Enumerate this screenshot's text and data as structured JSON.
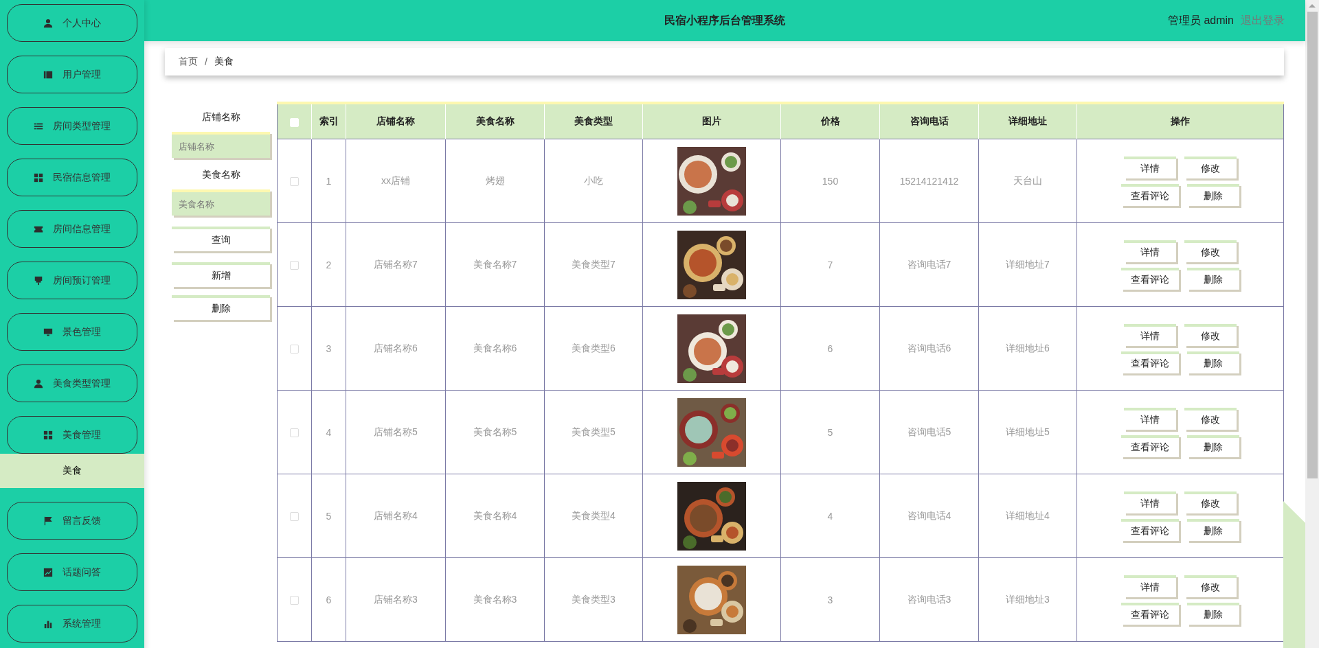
{
  "sidebar": {
    "items": [
      {
        "label": "个人中心",
        "selected": false
      },
      {
        "label": "用户管理",
        "selected": false
      },
      {
        "label": "房间类型管理",
        "selected": false
      },
      {
        "label": "民宿信息管理",
        "selected": false
      },
      {
        "label": "房间信息管理",
        "selected": false
      },
      {
        "label": "房间预订管理",
        "selected": false
      },
      {
        "label": "景色管理",
        "selected": false
      },
      {
        "label": "美食类型管理",
        "selected": false
      },
      {
        "label": "美食管理",
        "selected": false,
        "children": [
          {
            "label": "美食",
            "selected": true
          }
        ]
      },
      {
        "label": "留言反馈",
        "selected": false
      },
      {
        "label": "话题问答",
        "selected": false
      },
      {
        "label": "系统管理",
        "selected": false
      }
    ]
  },
  "header": {
    "title": "民宿小程序后台管理系统",
    "user": "管理员 admin",
    "logout": "退出登录"
  },
  "breadcrumb": [
    "首页",
    "美食"
  ],
  "breadcrumb_separator": "/",
  "filters": {
    "fields": [
      {
        "label": "店铺名称",
        "placeholder": "店铺名称"
      },
      {
        "label": "美食名称",
        "placeholder": "美食名称"
      }
    ],
    "buttons": [
      "查询",
      "新增",
      "删除"
    ]
  },
  "table": {
    "columns": [
      {
        "kind": "checkbox",
        "checked": false
      },
      {
        "kind": "text",
        "label": "索引"
      },
      {
        "kind": "text",
        "label": "店铺名称"
      },
      {
        "kind": "text",
        "label": "美食名称"
      },
      {
        "kind": "text",
        "label": "美食类型"
      },
      {
        "kind": "text",
        "label": "图片"
      },
      {
        "kind": "text",
        "label": "价格"
      },
      {
        "kind": "text",
        "label": "咨询电话"
      },
      {
        "kind": "text",
        "label": "详细地址"
      },
      {
        "kind": "text",
        "label": "操作"
      }
    ],
    "rows": [
      {
        "cells": [
          {
            "kind": "checkbox",
            "checked": false
          },
          {
            "kind": "text",
            "text": "1"
          },
          {
            "kind": "text",
            "text": "xx店铺"
          },
          {
            "kind": "text",
            "text": "烤翅"
          },
          {
            "kind": "text",
            "text": "小吃"
          },
          {
            "kind": "picture"
          },
          {
            "kind": "text",
            "text": "150"
          },
          {
            "kind": "text",
            "text": "15214121412"
          },
          {
            "kind": "text",
            "text": "天台山"
          },
          {
            "kind": "actions",
            "actions": [
              "详情",
              "修改",
              "查看评论",
              "删除"
            ]
          }
        ]
      },
      {
        "cells": [
          {
            "kind": "checkbox",
            "checked": false
          },
          {
            "kind": "text",
            "text": "2"
          },
          {
            "kind": "text",
            "text": "店铺名称7"
          },
          {
            "kind": "text",
            "text": "美食名称7"
          },
          {
            "kind": "text",
            "text": "美食类型7"
          },
          {
            "kind": "picture"
          },
          {
            "kind": "text",
            "text": "7"
          },
          {
            "kind": "text",
            "text": "咨询电话7"
          },
          {
            "kind": "text",
            "text": "详细地址7"
          },
          {
            "kind": "actions",
            "actions": [
              "详情",
              "修改",
              "查看评论",
              "删除"
            ]
          }
        ]
      },
      {
        "cells": [
          {
            "kind": "checkbox",
            "checked": false
          },
          {
            "kind": "text",
            "text": "3"
          },
          {
            "kind": "text",
            "text": "店铺名称6"
          },
          {
            "kind": "text",
            "text": "美食名称6"
          },
          {
            "kind": "text",
            "text": "美食类型6"
          },
          {
            "kind": "picture"
          },
          {
            "kind": "text",
            "text": "6"
          },
          {
            "kind": "text",
            "text": "咨询电话6"
          },
          {
            "kind": "text",
            "text": "详细地址6"
          },
          {
            "kind": "actions",
            "actions": [
              "详情",
              "修改",
              "查看评论",
              "删除"
            ]
          }
        ]
      },
      {
        "cells": [
          {
            "kind": "checkbox",
            "checked": false
          },
          {
            "kind": "text",
            "text": "4"
          },
          {
            "kind": "text",
            "text": "店铺名称5"
          },
          {
            "kind": "text",
            "text": "美食名称5"
          },
          {
            "kind": "text",
            "text": "美食类型5"
          },
          {
            "kind": "picture"
          },
          {
            "kind": "text",
            "text": "5"
          },
          {
            "kind": "text",
            "text": "咨询电话5"
          },
          {
            "kind": "text",
            "text": "详细地址5"
          },
          {
            "kind": "actions",
            "actions": [
              "详情",
              "修改",
              "查看评论",
              "删除"
            ]
          }
        ]
      },
      {
        "cells": [
          {
            "kind": "checkbox",
            "checked": false
          },
          {
            "kind": "text",
            "text": "5"
          },
          {
            "kind": "text",
            "text": "店铺名称4"
          },
          {
            "kind": "text",
            "text": "美食名称4"
          },
          {
            "kind": "text",
            "text": "美食类型4"
          },
          {
            "kind": "picture"
          },
          {
            "kind": "text",
            "text": "4"
          },
          {
            "kind": "text",
            "text": "咨询电话4"
          },
          {
            "kind": "text",
            "text": "详细地址4"
          },
          {
            "kind": "actions",
            "actions": [
              "详情",
              "修改",
              "查看评论",
              "删除"
            ]
          }
        ]
      },
      {
        "cells": [
          {
            "kind": "checkbox",
            "checked": false
          },
          {
            "kind": "text",
            "text": "6"
          },
          {
            "kind": "text",
            "text": "店铺名称3"
          },
          {
            "kind": "text",
            "text": "美食名称3"
          },
          {
            "kind": "text",
            "text": "美食类型3"
          },
          {
            "kind": "picture"
          },
          {
            "kind": "text",
            "text": "3"
          },
          {
            "kind": "text",
            "text": "咨询电话3"
          },
          {
            "kind": "text",
            "text": "详细地址3"
          },
          {
            "kind": "actions",
            "actions": [
              "详情",
              "修改",
              "查看评论",
              "删除"
            ]
          }
        ]
      }
    ]
  }
}
